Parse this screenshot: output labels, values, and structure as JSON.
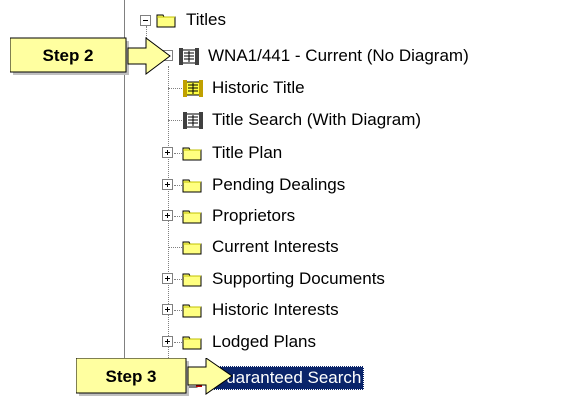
{
  "tree": {
    "root": {
      "label": "Titles",
      "icon": "folder-icon"
    },
    "title_node": {
      "label": "WNA1/441 - Current (No Diagram)",
      "icon": "title-document-icon"
    },
    "children": [
      {
        "label": "Historic Title",
        "icon": "historic-title-icon",
        "expandable": false
      },
      {
        "label": "Title Search (With Diagram)",
        "icon": "title-search-icon",
        "expandable": false
      },
      {
        "label": "Title Plan",
        "icon": "folder-icon",
        "expandable": true
      },
      {
        "label": "Pending Dealings",
        "icon": "folder-icon",
        "expandable": true
      },
      {
        "label": "Proprietors",
        "icon": "folder-icon",
        "expandable": true
      },
      {
        "label": "Current Interests",
        "icon": "folder-icon",
        "expandable": false
      },
      {
        "label": "Supporting Documents",
        "icon": "folder-icon",
        "expandable": true
      },
      {
        "label": "Historic Interests",
        "icon": "folder-icon",
        "expandable": true
      },
      {
        "label": "Lodged Plans",
        "icon": "folder-icon",
        "expandable": true
      },
      {
        "label": "Guaranteed Search",
        "icon": "guaranteed-search-icon",
        "expandable": false,
        "selected": true
      }
    ]
  },
  "callouts": {
    "step2": "Step 2",
    "step3": "Step 3"
  },
  "colors": {
    "folder": "#ffff80",
    "callout_fill": "#ffffa0",
    "selection": "#0a246a"
  }
}
